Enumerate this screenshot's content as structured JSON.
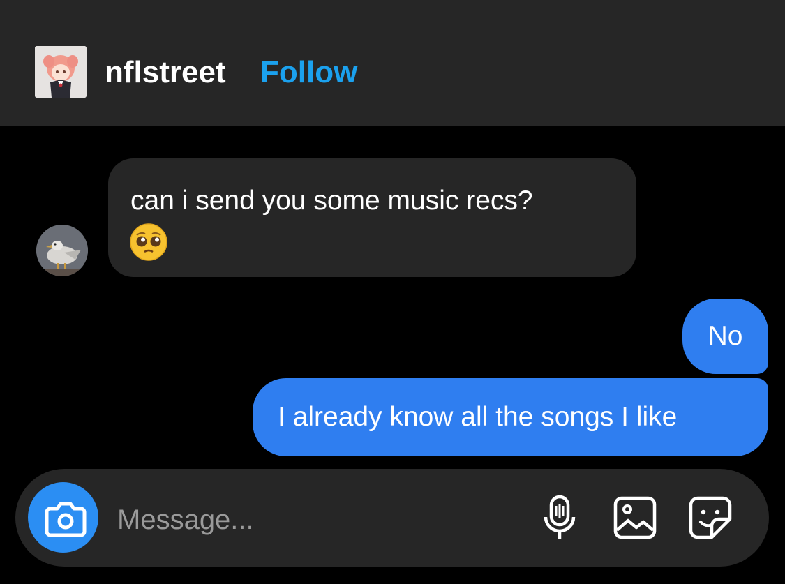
{
  "header": {
    "username": "nflstreet",
    "follow_label": "Follow"
  },
  "messages": [
    {
      "direction": "incoming",
      "text": "can i send you some music recs?",
      "emoji": "pleading-face"
    },
    {
      "direction": "outgoing",
      "text": "No"
    },
    {
      "direction": "outgoing",
      "text": "I already know all the songs I like"
    }
  ],
  "composer": {
    "placeholder": "Message...",
    "icons": [
      "camera-icon",
      "microphone-icon",
      "image-icon",
      "sticker-icon"
    ]
  },
  "colors": {
    "header_bg": "#262626",
    "chat_bg": "#000000",
    "incoming_bubble": "#262626",
    "outgoing_bubble": "#2f7ef0",
    "follow": "#1ba1ee",
    "camera_button": "#2b8ef3"
  }
}
